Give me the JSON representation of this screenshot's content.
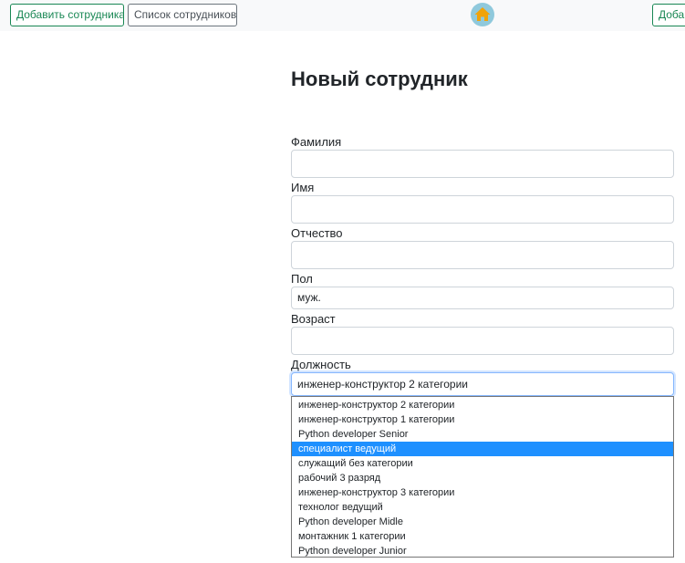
{
  "nav": {
    "add_employee_label": "Добавить сотрудника",
    "employee_list_label": "Список сотрудников",
    "add_right_label": "Добав",
    "home_icon": "home-icon"
  },
  "form": {
    "title": "Новый сотрудник",
    "fields": [
      {
        "label": "Фамилия",
        "value": ""
      },
      {
        "label": "Имя",
        "value": ""
      },
      {
        "label": "Отчество",
        "value": ""
      },
      {
        "label": "Пол",
        "value": "муж."
      },
      {
        "label": "Возраст",
        "value": ""
      }
    ],
    "position": {
      "label": "Должность",
      "selected": "инженер-конструктор 2 категории",
      "highlighted_index": 3,
      "options": [
        "инженер-конструктор 2 категории",
        "инженер-конструктор 1 категории",
        "Python developer Senior",
        "специалист ведущий",
        "служащий без категории",
        "рабочий 3 разряд",
        "инженер-конструктор 3 категории",
        "технолог ведущий",
        "Python developer Midle",
        "монтажник 1 категории",
        "Python developer Junior"
      ]
    }
  },
  "colors": {
    "success": "#198754",
    "secondary": "#6c757d",
    "highlight": "#1e90ff",
    "home_bg": "#8fc9dc",
    "home_icon": "#f0a30a"
  }
}
